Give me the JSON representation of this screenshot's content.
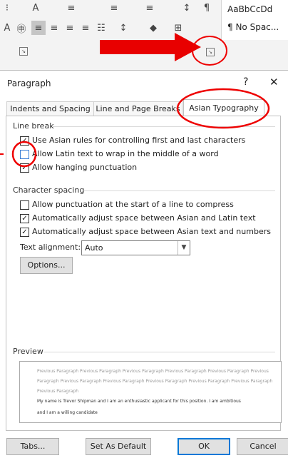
{
  "ribbon": {
    "style_normal": "AaBbCcDd",
    "style_nospacing": "¶ No Spac..."
  },
  "dialog": {
    "title": "Paragraph",
    "help": "?",
    "close": "✕",
    "tabs": [
      {
        "label": "Indents and Spacing"
      },
      {
        "label": "Line and Page Breaks"
      },
      {
        "label": "Asian Typography",
        "active": true
      }
    ],
    "line_break": {
      "header": "Line break",
      "options": [
        {
          "label": "Use Asian rules for controlling first and last characters",
          "checked": true
        },
        {
          "label": "Allow Latin text to wrap in the middle of a word",
          "checked": false
        },
        {
          "label": "Allow hanging punctuation",
          "checked": true
        }
      ]
    },
    "character_spacing": {
      "header": "Character spacing",
      "options": [
        {
          "label": "Allow punctuation at the start of a line to compress",
          "checked": false
        },
        {
          "label": "Automatically adjust space between Asian and Latin text",
          "checked": true
        },
        {
          "label": "Automatically adjust space between Asian text and numbers",
          "checked": true
        }
      ]
    },
    "text_alignment": {
      "label": "Text alignment:",
      "value": "Auto"
    },
    "options_button": "Options...",
    "preview": {
      "header": "Preview",
      "prev_lines": [
        "Previous Paragraph Previous Paragraph Previous Paragraph Previous Paragraph Previous Paragraph Previous",
        "Paragraph Previous Paragraph Previous Paragraph Previous Paragraph Previous Paragraph Previous Paragraph",
        "Previous Paragraph"
      ],
      "main_lines": [
        "My name is Trevor Shipman and I am an enthusiastic applicant for this position.  I am ambitious",
        "and I am a willing candidate"
      ]
    },
    "buttons": {
      "tabs": "Tabs...",
      "set_default": "Set As Default",
      "ok": "OK",
      "cancel": "Cancel"
    }
  }
}
